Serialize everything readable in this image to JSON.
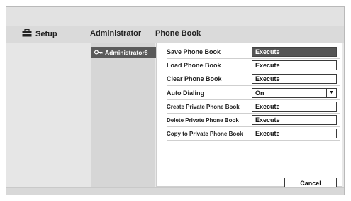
{
  "header": {
    "setup": "Setup",
    "administrator": "Administrator",
    "phone_book": "Phone Book"
  },
  "sidebar": {
    "selected_item": "Administrator8"
  },
  "panel": {
    "rows": [
      {
        "label": "Save Phone Book",
        "control": "Execute",
        "state": "active"
      },
      {
        "label": "Load Phone Book",
        "control": "Execute"
      },
      {
        "label": "Clear Phone Book",
        "control": "Execute"
      },
      {
        "label": "Auto Dialing",
        "control": "On",
        "type": "select"
      },
      {
        "label": "Create Private Phone Book",
        "control": "Execute"
      },
      {
        "label": "Delete Private Phone Book",
        "control": "Execute"
      },
      {
        "label": "Copy to Private Phone Book",
        "control": "Execute"
      }
    ],
    "cancel_label": "Cancel"
  },
  "icons": {
    "setup": "toolbox-icon",
    "administrator": "key-icon",
    "dropdown": "chevron-down-icon"
  }
}
